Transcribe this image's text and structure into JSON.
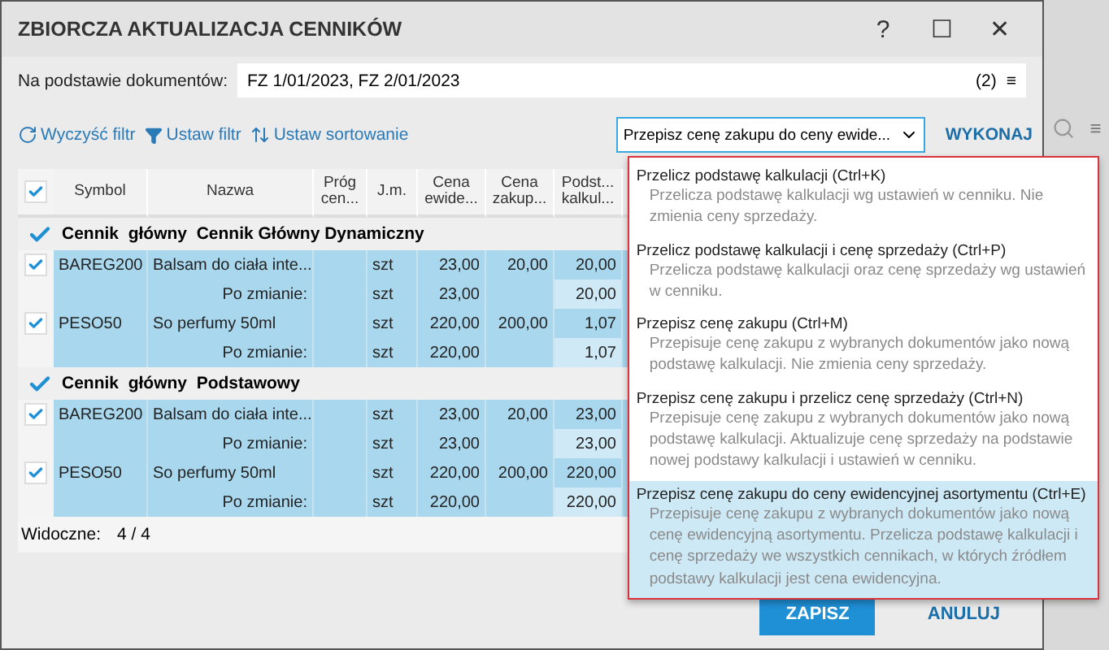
{
  "window": {
    "title": "ZBIORCZA AKTUALIZACJA CENNIKÓW",
    "buttons": [
      "?",
      "☐",
      "✕"
    ]
  },
  "documents": {
    "label": "Na podstawie dokumentów:",
    "value": "FZ 1/01/2023, FZ 2/01/2023",
    "count": "(2)",
    "menu": "≡"
  },
  "toolbar": {
    "actions": [
      {
        "kind": "clear",
        "label": "Wyczyść filtr"
      },
      {
        "kind": "filter",
        "label": "Ustaw filtr"
      },
      {
        "kind": "sort",
        "label": "Ustaw sortowanie"
      }
    ],
    "operation": "Przepisz cenę zakupu do ceny ewide...",
    "run": "WYKONAJ"
  },
  "side": {
    "menu": "≡"
  },
  "table": {
    "header_checked": true,
    "columns": [
      "Symbol",
      "Nazwa",
      "Próg cen...",
      "J.m.",
      "Cena ewide...",
      "Cena zakup...",
      "Podst... kalkul..."
    ],
    "groups": [
      {
        "checked": true,
        "name": "Cennik  główny  Cennik Główny Dynamiczny",
        "rows": [
          {
            "checked": true,
            "symbol": "BAREG200",
            "name": "Balsam do ciała inte...",
            "unit": "szt",
            "cena_ewid": "23,00",
            "cena_zakupu": "20,00",
            "podstawa": "20,00",
            "after_label": "Po zmianie:",
            "after_unit": "szt",
            "after_cena_ewid": "23,00",
            "after_podstawa": "20,00"
          },
          {
            "checked": true,
            "symbol": "PESO50",
            "name": "So perfumy 50ml",
            "unit": "szt",
            "cena_ewid": "220,00",
            "cena_zakupu": "200,00",
            "podstawa": "1,07",
            "after_label": "Po zmianie:",
            "after_unit": "szt",
            "after_cena_ewid": "220,00",
            "after_podstawa": "1,07"
          }
        ]
      },
      {
        "checked": true,
        "name": "Cennik  główny  Podstawowy",
        "rows": [
          {
            "checked": true,
            "symbol": "BAREG200",
            "name": "Balsam do ciała inte...",
            "unit": "szt",
            "cena_ewid": "23,00",
            "cena_zakupu": "20,00",
            "podstawa": "23,00",
            "after_label": "Po zmianie:",
            "after_unit": "szt",
            "after_cena_ewid": "23,00",
            "after_podstawa": "23,00"
          },
          {
            "checked": true,
            "symbol": "PESO50",
            "name": "So perfumy 50ml",
            "unit": "szt",
            "cena_ewid": "220,00",
            "cena_zakupu": "200,00",
            "podstawa": "220,00",
            "after_label": "Po zmianie:",
            "after_unit": "szt",
            "after_cena_ewid": "220,00",
            "after_podstawa": "220,00"
          }
        ]
      }
    ],
    "footer_label": "Widoczne:",
    "footer_value": "4 /  4"
  },
  "dropdown": {
    "options": [
      {
        "title": "Przelicz podstawę kalkulacji  (Ctrl+K)",
        "description": "Przelicza podstawę kalkulacji wg ustawień w cenniku. Nie zmienia ceny sprzedaży.",
        "selected": false
      },
      {
        "title": "Przelicz podstawę kalkulacji i cenę sprzedaży  (Ctrl+P)",
        "description": "Przelicza podstawę kalkulacji oraz cenę sprzedaży wg ustawień w cenniku.",
        "selected": false
      },
      {
        "title": "Przepisz cenę zakupu  (Ctrl+M)",
        "description": "Przepisuje cenę zakupu z wybranych dokumentów jako nową podstawę kalkulacji. Nie zmienia ceny sprzedaży.",
        "selected": false
      },
      {
        "title": "Przepisz cenę zakupu i przelicz cenę sprzedaży  (Ctrl+N)",
        "description": "Przepisuje cenę zakupu z wybranych dokumentów jako nową podstawę kalkulacji. Aktualizuje cenę sprzedaży na podstawie nowej podstawy kalkulacji i ustawień w cenniku.",
        "selected": false
      },
      {
        "title": "Przepisz cenę zakupu do ceny ewidencyjnej asortymentu  (Ctrl+E)",
        "description": "Przepisuje cenę zakupu z wybranych dokumentów jako nową cenę ewidencyjną asortymentu. Przelicza podstawę kalkulacji i cenę sprzedaży we wszystkich cennikach, w których źródłem podstawy kalkulacji jest cena ewidencyjna.",
        "selected": true
      }
    ]
  },
  "footer_buttons": [
    {
      "kind": "primary",
      "label": "ZAPISZ"
    },
    {
      "kind": "link",
      "label": "ANULUJ"
    }
  ]
}
